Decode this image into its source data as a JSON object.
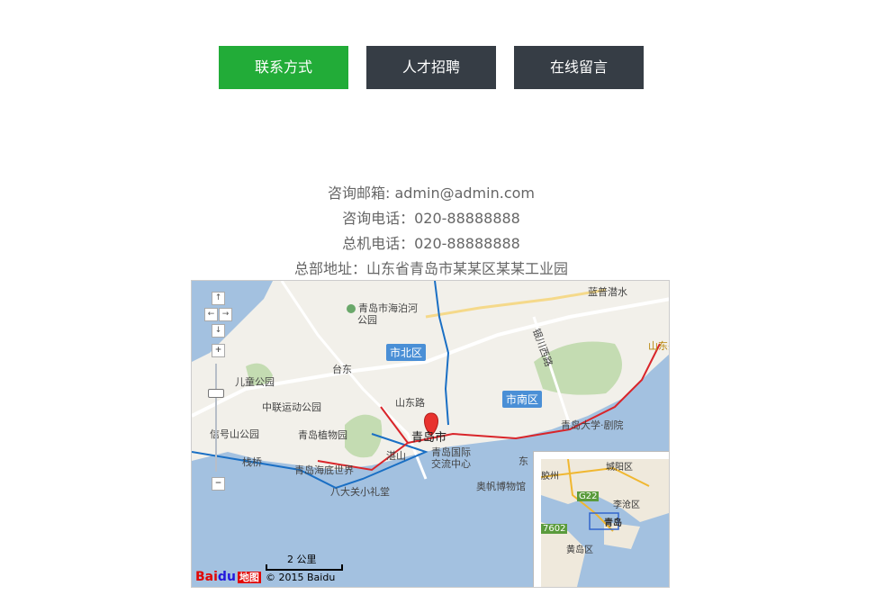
{
  "tabs": [
    {
      "label": "联系方式",
      "active": true
    },
    {
      "label": "人才招聘",
      "active": false
    },
    {
      "label": "在线留言",
      "active": false
    }
  ],
  "contact": {
    "email": "咨询邮箱: admin@admin.com",
    "phone": "咨询电话：020-88888888",
    "switchboard": "总机电话：020-88888888",
    "address": "总部地址：山东省青岛市某某区某某工业园"
  },
  "map": {
    "labels": {
      "lanyu": "蓝普潜水",
      "haibohe": "青岛市海泊河",
      "park": "公园",
      "shibei": "市北区",
      "taidong": "台东",
      "shandonglu": "山东路",
      "shinan": "市南区",
      "ertong": "儿童公园",
      "zhonglian": "中联运动公园",
      "qingdaodaxue": "青岛大学·剧院",
      "xinhao": "信号山公园",
      "zhiwuyuan": "青岛植物园",
      "qingdaoshi": "青岛市",
      "zhanshan": "湛山",
      "guoji": "青岛国际",
      "jiaoliu": "交流中心",
      "zhanqiao": "栈桥",
      "haidi": "青岛海底世界",
      "badaguan": "八大关小礼堂",
      "aofan": "奥帆博物馆",
      "dong": "东",
      "shandongtou": "山东头",
      "yinchuan": "银川西路"
    },
    "overview": {
      "chengyang": "城阳区",
      "jiaozhou": "胶州",
      "g22": "G22",
      "licang": "李沧区",
      "qingdao": "青岛",
      "s7602": "7602",
      "huangdao": "黄岛区"
    },
    "scale": "2 公里",
    "copyright": "© 2015 Baidu",
    "logo_bai": "Bai",
    "logo_du": "du",
    "logo_map": "地图"
  }
}
